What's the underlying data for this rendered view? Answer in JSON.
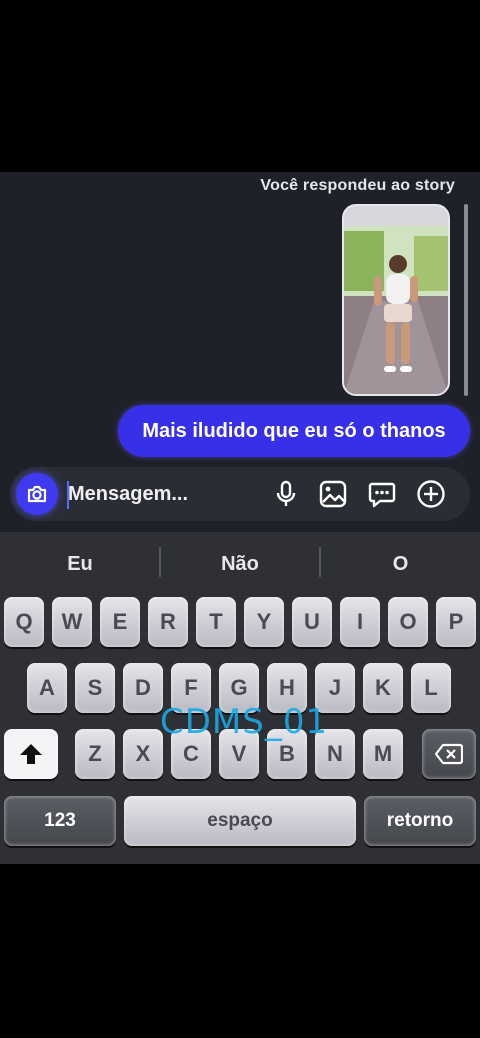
{
  "chat": {
    "story_label": "Você respondeu ao story",
    "message": "Mais iludido que eu só o thanos"
  },
  "composer": {
    "placeholder": "Mensagem...",
    "value": "",
    "icons": [
      "camera-icon",
      "microphone-icon",
      "gallery-icon",
      "sticker-icon",
      "plus-circle-icon"
    ]
  },
  "keyboard": {
    "suggestions": [
      "Eu",
      "Não",
      "O"
    ],
    "row1": [
      "Q",
      "W",
      "E",
      "R",
      "T",
      "Y",
      "U",
      "I",
      "O",
      "P"
    ],
    "row2": [
      "A",
      "S",
      "D",
      "F",
      "G",
      "H",
      "J",
      "K",
      "L"
    ],
    "row3": [
      "Z",
      "X",
      "C",
      "V",
      "B",
      "N",
      "M"
    ],
    "numbers_label": "123",
    "space_label": "espaço",
    "return_label": "retorno"
  },
  "watermark": "CDMS_01",
  "colors": {
    "bubble": "#3730e8",
    "camera_button": "#3d3af0",
    "chat_background": "#1f2128",
    "keyboard_background": "#2e3036",
    "watermark": "#1aa9e6"
  }
}
